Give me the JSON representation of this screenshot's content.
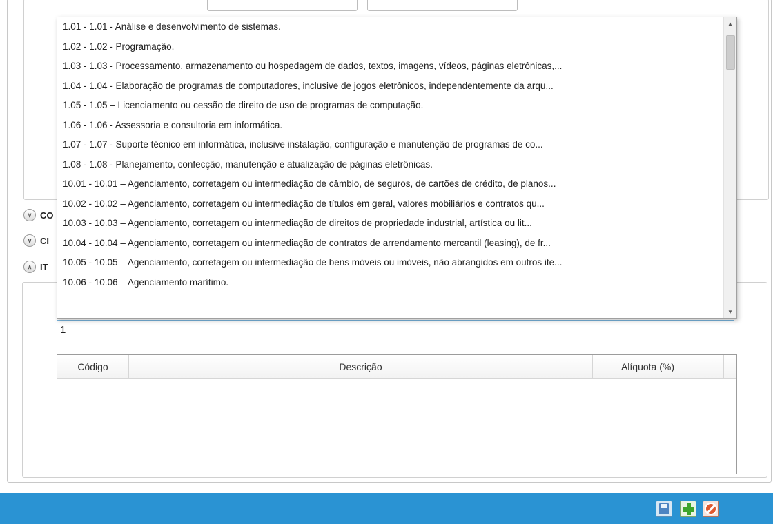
{
  "dropdown": {
    "items": [
      "1.01 - 1.01 - Análise e desenvolvimento de sistemas.",
      "1.02 - 1.02 - Programação.",
      "1.03 - 1.03 - Processamento, armazenamento ou hospedagem de dados, textos, imagens, vídeos, páginas eletrônicas,...",
      "1.04 - 1.04 - Elaboração de programas de computadores, inclusive de jogos eletrônicos, independentemente da arqu...",
      "1.05 - 1.05 – Licenciamento ou cessão de direito de uso de programas de computação.",
      "1.06 - 1.06 - Assessoria e consultoria em informática.",
      "1.07 - 1.07 - Suporte técnico em informática, inclusive instalação, configuração e manutenção de programas de co...",
      "1.08 - 1.08 - Planejamento, confecção, manutenção e atualização de páginas eletrônicas.",
      "10.01 - 10.01 – Agenciamento, corretagem ou intermediação de câmbio, de seguros, de cartões de crédito, de planos...",
      "10.02 - 10.02 – Agenciamento, corretagem ou intermediação de títulos em geral, valores mobiliários e contratos qu...",
      "10.03 - 10.03 – Agenciamento, corretagem ou intermediação de direitos de propriedade industrial, artística ou lit...",
      "10.04 - 10.04 – Agenciamento, corretagem ou intermediação de contratos de arrendamento mercantil (leasing), de fr...",
      "10.05 - 10.05 – Agenciamento, corretagem ou intermediação de bens móveis ou imóveis, não abrangidos em outros ite...",
      "10.06 - 10.06 – Agenciamento marítimo."
    ]
  },
  "expanders": [
    {
      "label": "CO"
    },
    {
      "label": "CI"
    },
    {
      "label": "IT"
    }
  ],
  "search": {
    "value": "1"
  },
  "grid": {
    "columns": {
      "code": "Código",
      "description": "Descrição",
      "rate": "Alíquota (%)"
    }
  },
  "colors": {
    "footer_bar": "#2a93d3",
    "input_focus_border": "#7ab7e0"
  },
  "toolbar": {
    "icons": [
      "save-icon",
      "add-icon",
      "cancel-icon"
    ]
  }
}
